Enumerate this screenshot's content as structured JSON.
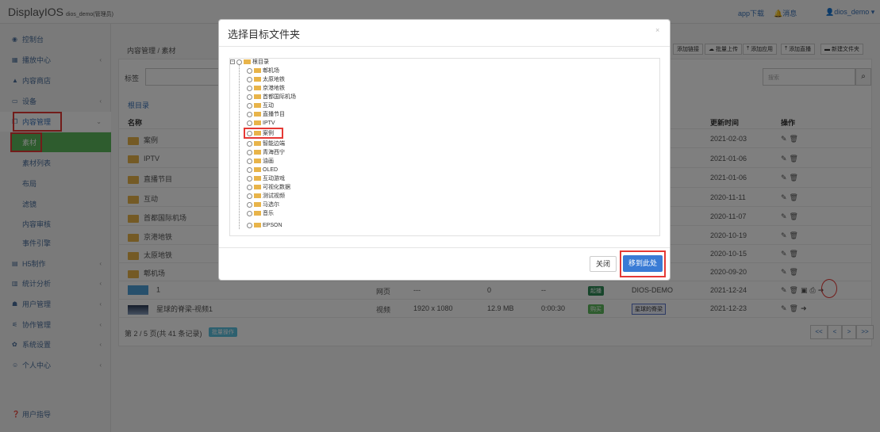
{
  "topbar": {
    "brand": "DisplayIOS",
    "brand_sub": "dios_demo(管理员)",
    "app_download": "app下载",
    "messages": "消息",
    "user": "dios_demo"
  },
  "sidebar": {
    "items": [
      {
        "label": "控制台"
      },
      {
        "label": "播放中心"
      },
      {
        "label": "内容商店"
      },
      {
        "label": "设备"
      },
      {
        "label": "内容管理"
      },
      {
        "label": "素材"
      },
      {
        "label": "素材列表"
      },
      {
        "label": "布局"
      },
      {
        "label": "滤镜"
      },
      {
        "label": "内容审核"
      },
      {
        "label": "事件引擎"
      },
      {
        "label": "H5制作"
      },
      {
        "label": "统计分析"
      },
      {
        "label": "用户管理"
      },
      {
        "label": "协作管理"
      },
      {
        "label": "系统设置"
      },
      {
        "label": "个人中心"
      },
      {
        "label": "用户指导"
      }
    ]
  },
  "breadcrumb": {
    "root": "内容管理",
    "current": "素材"
  },
  "toolbar": {
    "add_link": "添加链接",
    "batch_upload": "批量上传",
    "add_app": "添加应用",
    "add_live": "添加直播",
    "new_folder": "新建文件夹"
  },
  "filter": {
    "tag_label": "标签",
    "search_placeholder": "搜索"
  },
  "root_link": "根目录",
  "table": {
    "headers": {
      "name": "名称",
      "updated": "更新时间",
      "actions": "操作"
    },
    "folders": [
      {
        "name": "案例",
        "updated": "2021-02-03"
      },
      {
        "name": "IPTV",
        "updated": "2021-01-06"
      },
      {
        "name": "直播节目",
        "updated": "2021-01-06"
      },
      {
        "name": "互动",
        "updated": "2020-11-11"
      },
      {
        "name": "首都国际机场",
        "updated": "2020-11-07"
      },
      {
        "name": "京港地铁",
        "updated": "2020-10-19"
      },
      {
        "name": "太原地铁",
        "updated": "2020-10-15"
      },
      {
        "name": "郫机场",
        "updated": "2020-09-20"
      }
    ],
    "items": [
      {
        "name": "1",
        "type": "网页",
        "res": "---",
        "size": "0",
        "dur": "--",
        "status": "起播",
        "owner": "DIOS-DEMO",
        "updated": "2021-12-24"
      },
      {
        "name": "星球的脊梁-视频1",
        "type": "视频",
        "res": "1920 x 1080",
        "size": "12.9 MB",
        "dur": "0:00:30",
        "status": "购买",
        "owner": "星球的脊梁",
        "updated": "2021-12-23"
      }
    ]
  },
  "pager": {
    "text": "第 2 / 5 页(共 41 条记录)",
    "batch": "批量操作",
    "first": "<<",
    "prev": "<",
    "next": ">",
    "last": ">>"
  },
  "modal": {
    "title": "选择目标文件夹",
    "close_x": "×",
    "root": "根目录",
    "nodes": [
      "郫机场",
      "太原地铁",
      "京港地铁",
      "首都国际机场",
      "互动",
      "直播节目",
      "IPTV",
      "案例",
      "智能边端",
      "青海西宁",
      "油画",
      "OLED",
      "互动游戏",
      "可视化数据",
      "测试视频",
      "马选尔",
      "音乐",
      "EPSON"
    ],
    "btn_close": "关闭",
    "btn_move": "移到此处"
  },
  "colors": {
    "accent_green": "#5cb85c",
    "primary_blue": "#3a7bd5",
    "highlight_red": "#e53935"
  }
}
